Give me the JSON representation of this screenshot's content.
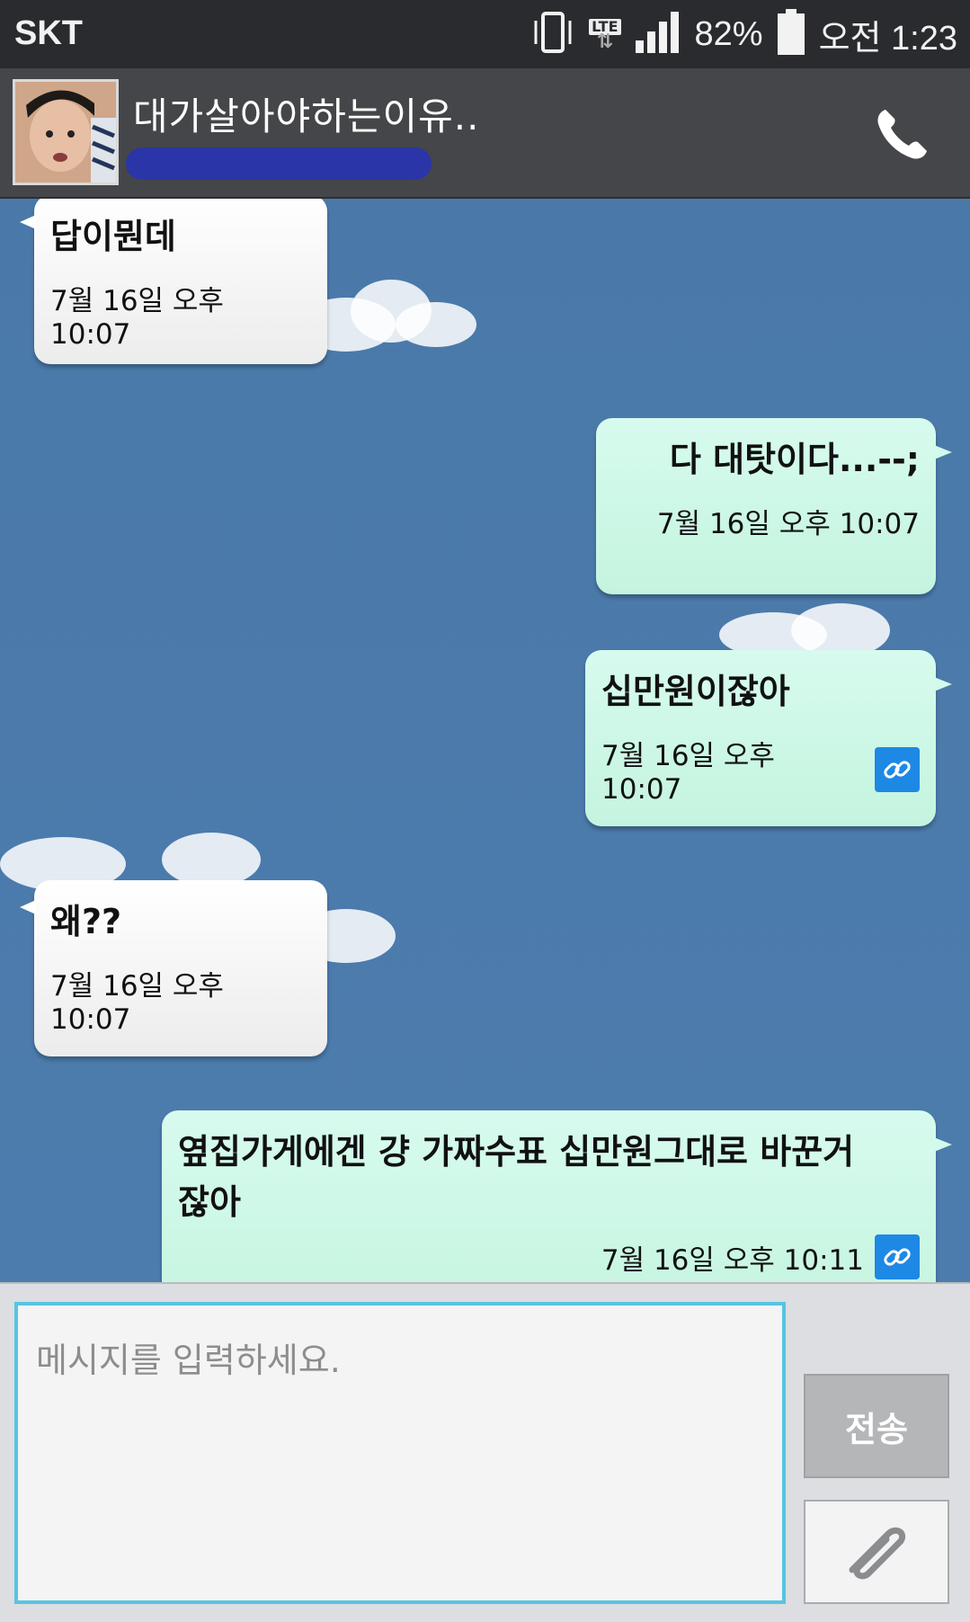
{
  "status_bar": {
    "carrier": "SKT",
    "network": "LTE",
    "battery": "82%",
    "time": "오전 1:23",
    "icons": [
      "vibrate-icon",
      "lte-data-icon",
      "signal-icon",
      "battery-icon"
    ]
  },
  "header": {
    "title": "대가살아야하는이유..",
    "call_icon": "phone-icon"
  },
  "messages": [
    {
      "direction": "in",
      "text": "답이뭔데",
      "time": "7월 16일 오후 10:07"
    },
    {
      "direction": "out",
      "text": "다 대탓이다...--;",
      "time": "7월 16일 오후 10:07"
    },
    {
      "direction": "out",
      "text": "십만원이잖아",
      "time": "7월 16일 오후 10:07",
      "icon": "link-icon"
    },
    {
      "direction": "in",
      "text": "왜??",
      "time": "7월 16일 오후 10:07"
    },
    {
      "direction": "out",
      "text": "옆집가게에겐 걍 가짜수표 십만원그대로 바꾼거잖아",
      "time": "7월 16일 오후 10:11",
      "icon": "link-icon"
    }
  ],
  "composer": {
    "placeholder": "메시지를 입력하세요.",
    "send_label": "전송",
    "attach_icon": "paperclip-icon"
  },
  "colors": {
    "chat_background": "#4b7aaa",
    "incoming_bubble": "#f4f4f4",
    "outgoing_bubble": "#c9f6e3",
    "input_border": "#57c4e2",
    "header": "#454649",
    "status_bar": "#2a2b2e"
  }
}
